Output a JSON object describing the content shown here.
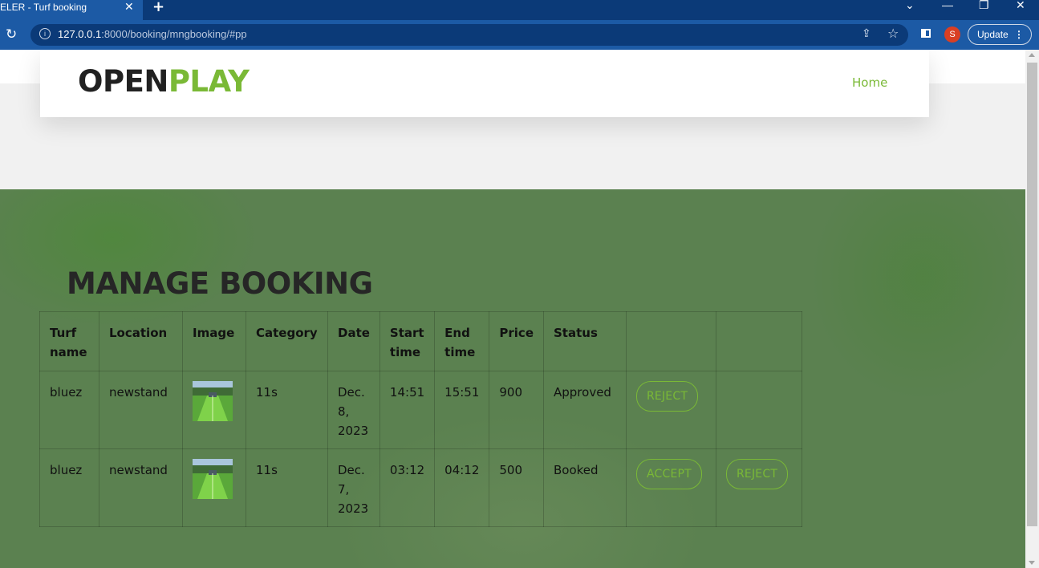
{
  "browser": {
    "tab_title": "ELER - Turf booking",
    "tab_close": "✕",
    "new_tab": "+",
    "window_controls": {
      "collapse": "⌄",
      "minimize": "—",
      "restore": "❐",
      "close": "✕"
    },
    "url_host": "127.0.0.1",
    "url_rest": ":8000/booking/mngbooking/#pp",
    "profile_initial": "S",
    "update_label": "Update",
    "menu_glyph": "⋮"
  },
  "site": {
    "logo_part1": "OPEN",
    "logo_part2": "PLAY",
    "nav_home": "Home",
    "brand_color": "#7ab936"
  },
  "page": {
    "title": "MANAGE BOOKING",
    "columns": [
      "Turf name",
      "Location",
      "Image",
      "Category",
      "Date",
      "Start time",
      "End time",
      "Price",
      "Status",
      "",
      ""
    ],
    "rows": [
      {
        "turf": "bluez",
        "location": "newstand",
        "category": "11s",
        "date": "Dec. 8, 2023",
        "start": "14:51",
        "end": "15:51",
        "price": "900",
        "status": "Approved",
        "action1": "REJECT",
        "action2": ""
      },
      {
        "turf": "bluez",
        "location": "newstand",
        "category": "11s",
        "date": "Dec. 7, 2023",
        "start": "03:12",
        "end": "04:12",
        "price": "500",
        "status": "Booked",
        "action1": "ACCEPT",
        "action2": "REJECT"
      }
    ]
  }
}
